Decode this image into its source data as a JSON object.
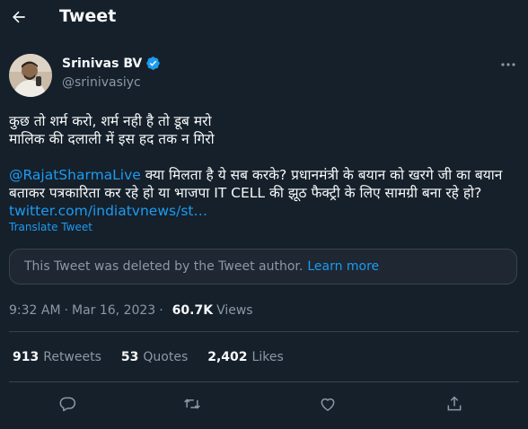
{
  "header": {
    "title": "Tweet"
  },
  "author": {
    "name": "Srinivas BV",
    "handle": "@srinivasiyc",
    "verified": true
  },
  "tweet": {
    "line1": "कुछ तो शर्म करो, शर्म नही है तो डूब मरो",
    "line2": "मालिक की दलाली में इस हद तक न गिरो",
    "mention": "@RajatSharmaLive",
    "body": " क्या मिलता है ये सब करके? प्रधानमंत्री के बयान को खरगे जी का बयान बताकर पत्रकारिता कर रहे हो या भाजपा IT CELL की झूठ फैक्ट्री के लिए सामग्री बना रहे हो? ",
    "link": "twitter.com/indiatvnews/st…"
  },
  "translate_label": "Translate Tweet",
  "deleted_notice": {
    "text": "This Tweet was deleted by the Tweet author.",
    "link": "Learn more"
  },
  "meta": {
    "time": "9:32 AM",
    "separator": "·",
    "date": "Mar 16, 2023",
    "views": "60.7K",
    "views_label": "Views"
  },
  "stats": {
    "retweets": {
      "count": "913",
      "label": "Retweets"
    },
    "quotes": {
      "count": "53",
      "label": "Quotes"
    },
    "likes": {
      "count": "2,402",
      "label": "Likes"
    }
  },
  "colors": {
    "background": "#15202b",
    "accent": "#1d9bf0",
    "text": "#f7f9f9",
    "muted": "#8b98a5",
    "border": "#38444d"
  },
  "icons": [
    "back-arrow-icon",
    "verified-badge-icon",
    "more-icon",
    "reply-icon",
    "retweet-icon",
    "like-icon",
    "share-icon"
  ]
}
